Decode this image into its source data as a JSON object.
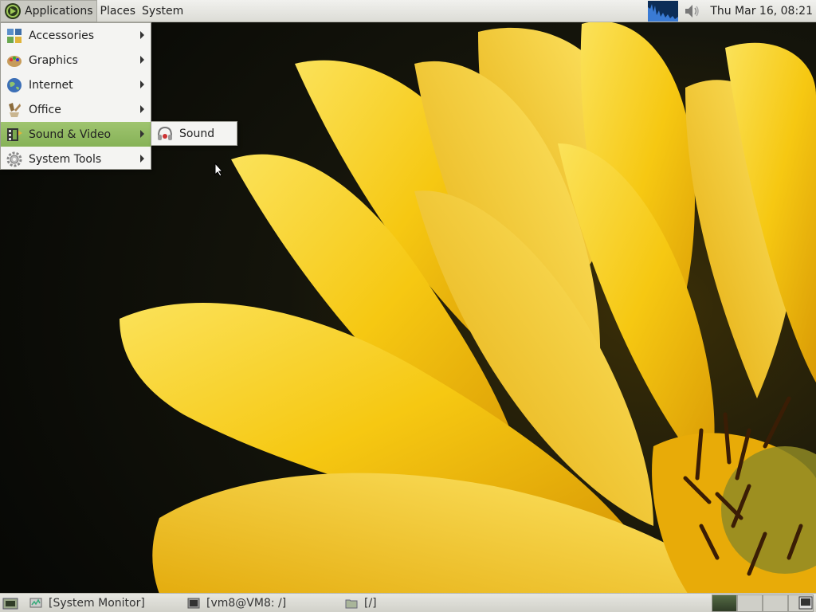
{
  "top_panel": {
    "menus": [
      "Applications",
      "Places",
      "System"
    ],
    "clock": "Thu Mar 16, 08:21",
    "icons": {
      "logo": "distro-logo-icon",
      "monitor": "system-monitor-graph-icon",
      "volume": "volume-icon"
    }
  },
  "applications_menu": {
    "items": [
      {
        "label": "Accessories",
        "icon": "accessories-icon",
        "has_submenu": true
      },
      {
        "label": "Graphics",
        "icon": "graphics-icon",
        "has_submenu": true
      },
      {
        "label": "Internet",
        "icon": "internet-globe-icon",
        "has_submenu": true
      },
      {
        "label": "Office",
        "icon": "office-icon",
        "has_submenu": true
      },
      {
        "label": "Sound & Video",
        "icon": "sound-video-icon",
        "has_submenu": true,
        "highlighted": true
      },
      {
        "label": "System Tools",
        "icon": "system-tools-gear-icon",
        "has_submenu": true
      }
    ]
  },
  "sound_video_submenu": {
    "items": [
      {
        "label": "Sound",
        "icon": "sound-headphones-icon"
      }
    ]
  },
  "bottom_panel": {
    "tasks": [
      {
        "label": "[System Monitor]",
        "icon": "system-monitor-icon"
      },
      {
        "label": "[vm8@VM8: /]",
        "icon": "terminal-icon"
      },
      {
        "label": "[/]",
        "icon": "folder-icon"
      }
    ],
    "workspace_count": 4,
    "active_workspace": 1
  },
  "colors": {
    "menu_highlight": "#8fb960",
    "panel_bg": "#e4e4df",
    "monitor_graph": "#0c2d57",
    "flower_yellow": "#f5c70f"
  }
}
